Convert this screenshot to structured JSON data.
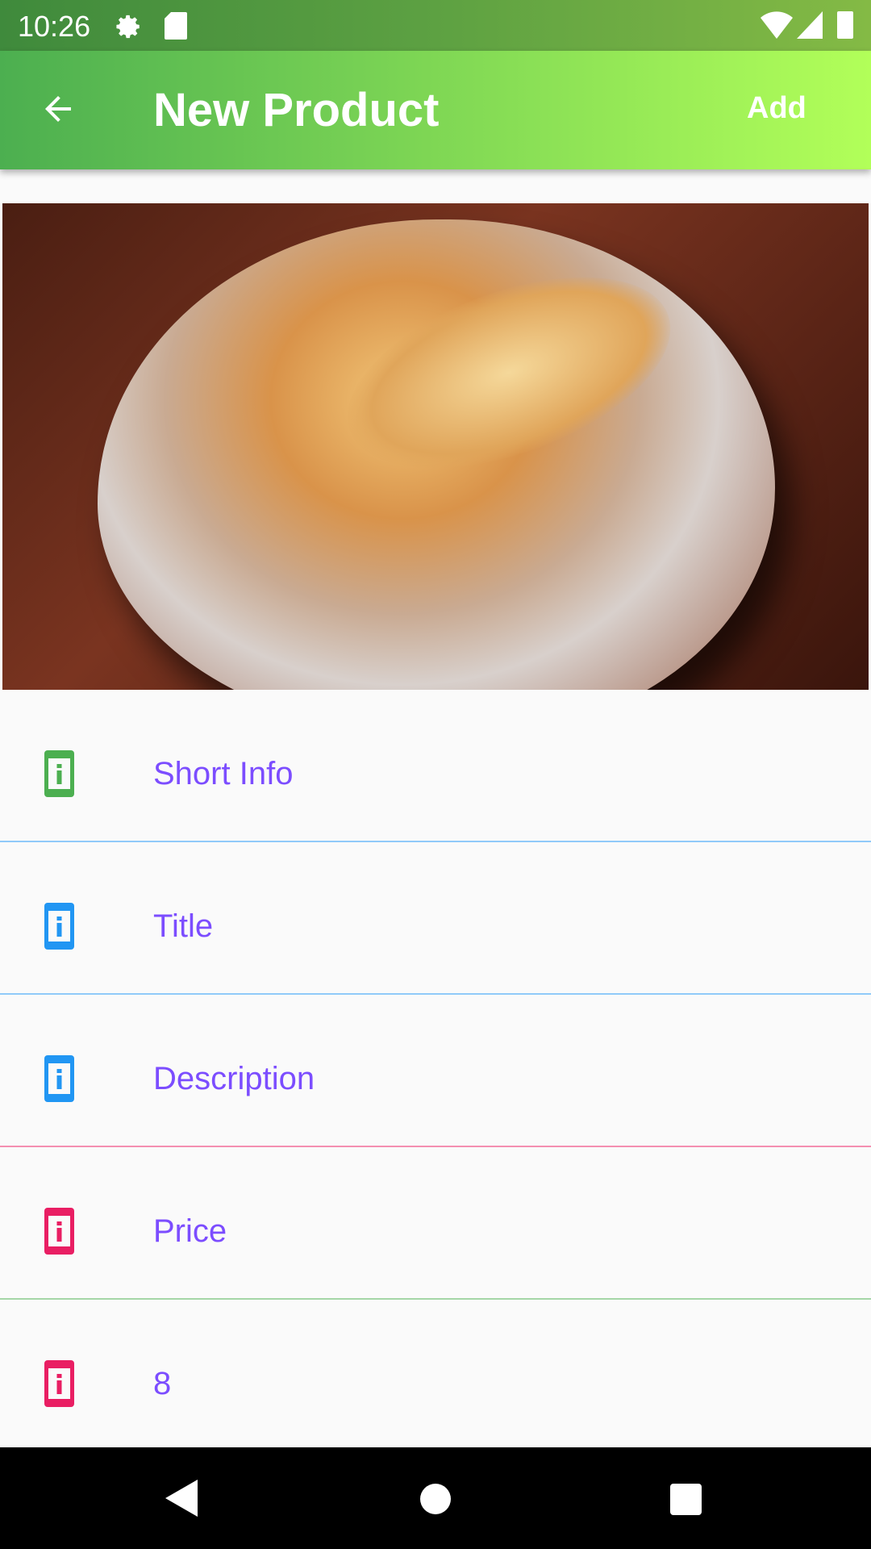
{
  "status_bar": {
    "time": "10:26",
    "icons": [
      "gear-icon",
      "sd-card-icon",
      "wifi-icon",
      "signal-icon",
      "battery-icon"
    ]
  },
  "app_bar": {
    "title": "New Product",
    "action": "Add",
    "back_icon": "arrow-back-icon"
  },
  "fields": [
    {
      "label": "Short Info",
      "icon": "info-icon",
      "icon_color": "#4caf50",
      "divider_color": "#90caf9"
    },
    {
      "label": "Title",
      "icon": "info-icon",
      "icon_color": "#2196f3",
      "divider_color": "#90caf9"
    },
    {
      "label": "Description",
      "icon": "info-icon",
      "icon_color": "#2196f3",
      "divider_color": "#f48fb1"
    },
    {
      "label": "Price",
      "icon": "info-icon",
      "icon_color": "#e91e63",
      "divider_color": "#a5d6a7"
    },
    {
      "label": "8",
      "icon": "info-icon",
      "icon_color": "#e91e63",
      "divider_color": ""
    }
  ],
  "accent": "#7c4dff"
}
